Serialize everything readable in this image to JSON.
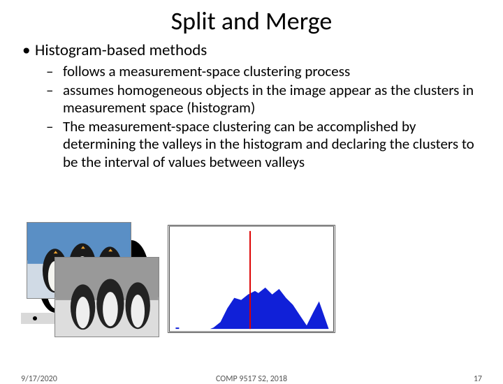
{
  "title": "Split and Merge",
  "bullet1": "Histogram-based methods",
  "sub1": "follows a measurement-space clustering process",
  "sub2": "assumes homogeneous objects in the image appear as the clusters in measurement space (histogram)",
  "sub3": "The measurement-space clustering can be accomplished by determining the valleys in the histogram and declaring the clusters to be the interval of values between valleys",
  "footer": {
    "date": "9/17/2020",
    "course": "COMP 9517 S2, 2018",
    "page": "17"
  }
}
